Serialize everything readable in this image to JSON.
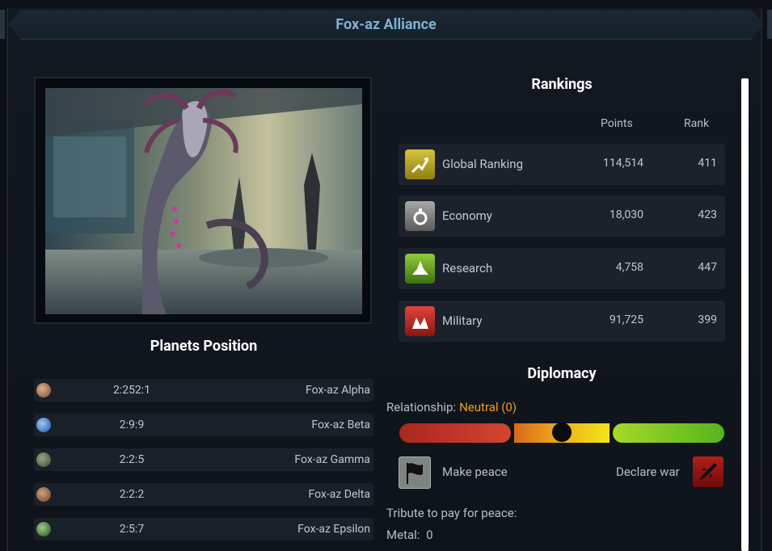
{
  "window": {
    "title": "Fox-az Alliance"
  },
  "planets_section": {
    "title": "Planets Position",
    "planets": [
      {
        "coords": "2:252:1",
        "name": "Fox-az Alpha",
        "icon": "planet-icon",
        "color": "#b07a5a"
      },
      {
        "coords": "2:9:9",
        "name": "Fox-az Beta",
        "icon": "planet-icon",
        "color": "#3c7fd0"
      },
      {
        "coords": "2:2:5",
        "name": "Fox-az Gamma",
        "icon": "planet-icon",
        "color": "#5a6b50"
      },
      {
        "coords": "2:2:2",
        "name": "Fox-az Delta",
        "icon": "planet-icon",
        "color": "#9a6a48"
      },
      {
        "coords": "2:5:7",
        "name": "Fox-az Epsilon",
        "icon": "planet-icon",
        "color": "#3d7a3a"
      }
    ]
  },
  "rankings": {
    "title": "Rankings",
    "col_points": "Points",
    "col_rank": "Rank",
    "rows": [
      {
        "label": "Global Ranking",
        "points": "114,514",
        "rank": "411",
        "icon": "global-ranking-icon",
        "color": "#b5a022"
      },
      {
        "label": "Economy",
        "points": "18,030",
        "rank": "423",
        "icon": "economy-icon",
        "color": "#7d7d7d"
      },
      {
        "label": "Research",
        "points": "4,758",
        "rank": "447",
        "icon": "research-icon",
        "color": "#69a623"
      },
      {
        "label": "Military",
        "points": "91,725",
        "rank": "399",
        "icon": "military-icon",
        "color": "#c2312b"
      }
    ]
  },
  "diplomacy": {
    "title": "Diplomacy",
    "relationship_label": "Relationship:",
    "relationship_value": "Neutral (0)",
    "relationship_level": 0.5,
    "make_peace": "Make peace",
    "declare_war": "Declare war",
    "tribute_label": "Tribute to pay for peace:",
    "metal_label": "Metal:",
    "metal_value": "0"
  },
  "colors": {
    "accent": "#7fb0d6",
    "neutral": "#f39a1b"
  }
}
